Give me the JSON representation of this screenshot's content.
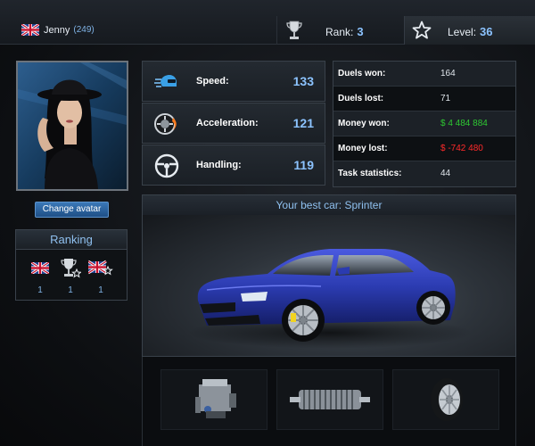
{
  "topbar": {
    "username": "Jenny",
    "user_count": "(249)",
    "rank_label": "Rank:",
    "rank_value": "3",
    "level_label": "Level:",
    "level_value": "36"
  },
  "sidebar": {
    "change_avatar_label": "Change avatar",
    "ranking_title": "Ranking",
    "ranking_items": [
      {
        "icon": "uk-flag-icon",
        "value": "1"
      },
      {
        "icon": "trophy-star-icon",
        "value": "1"
      },
      {
        "icon": "uk-flag-star-icon",
        "value": "1"
      }
    ]
  },
  "stats": [
    {
      "label": "Speed:",
      "value": "133",
      "icon": "speed-icon"
    },
    {
      "label": "Acceleration:",
      "value": "121",
      "icon": "acceleration-icon"
    },
    {
      "label": "Handling:",
      "value": "119",
      "icon": "steering-wheel-icon"
    }
  ],
  "duels": [
    {
      "label": "Duels won:",
      "value": "164",
      "color": "#e0e6ec"
    },
    {
      "label": "Duels lost:",
      "value": "71",
      "color": "#e0e6ec"
    },
    {
      "label": "Money won:",
      "value": "$ 4 484 884",
      "color": "#2ec832"
    },
    {
      "label": "Money lost:",
      "value": "$ -742 480",
      "color": "#ff2a2a"
    },
    {
      "label": "Task statistics:",
      "value": "44",
      "color": "#e0e6ec"
    }
  ],
  "best_car": {
    "title": "Your best car: Sprinter"
  },
  "parts": [
    {
      "icon": "engine-icon"
    },
    {
      "icon": "gearbox-icon"
    },
    {
      "icon": "tire-icon"
    }
  ],
  "colors": {
    "accent_blue": "#8cc3ff",
    "money_won": "#2ec832",
    "money_lost": "#ff2a2a",
    "car_body": "#2b3bb0"
  }
}
